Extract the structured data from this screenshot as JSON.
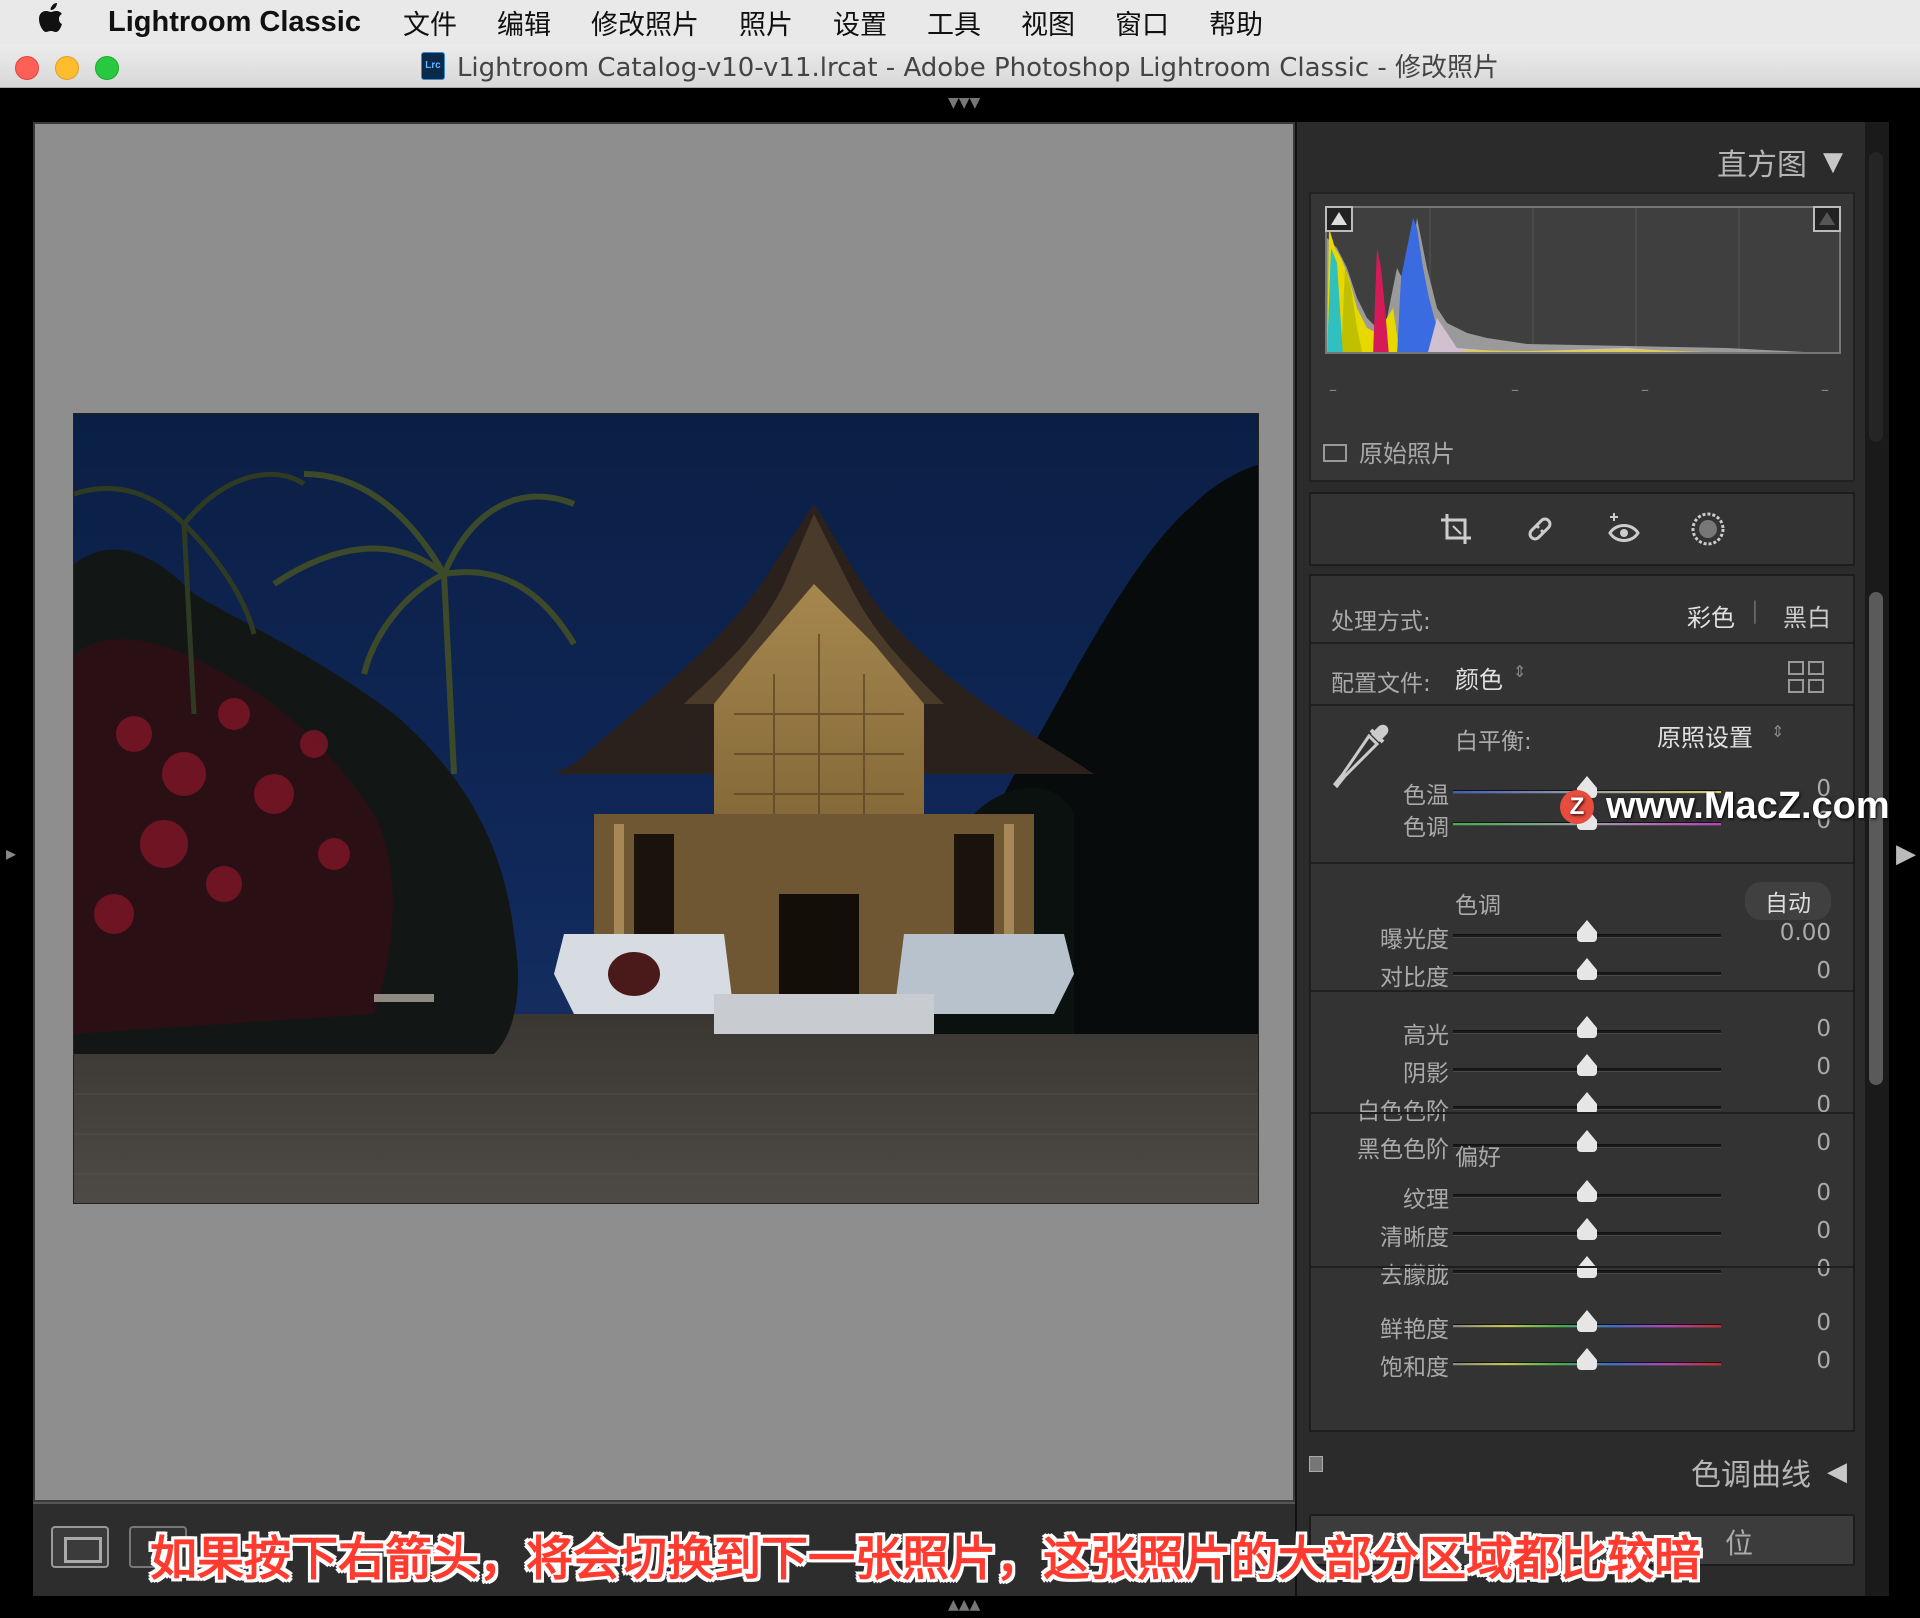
{
  "menubar": {
    "app_name": "Lightroom Classic",
    "items": [
      "文件",
      "编辑",
      "修改照片",
      "照片",
      "设置",
      "工具",
      "视图",
      "窗口",
      "帮助"
    ]
  },
  "window": {
    "title": "Lightroom Catalog-v10-v11.lrcat - Adobe Photoshop Lightroom Classic - 修改照片",
    "doc_icon_text": "Lrc"
  },
  "histogram": {
    "title": "直方图",
    "original_photo_label": "原始照片"
  },
  "basic": {
    "treatment_label": "处理方式:",
    "treatment_color": "彩色",
    "treatment_bw": "黑白",
    "profile_label": "配置文件:",
    "profile_value": "颜色",
    "wb_label": "白平衡:",
    "wb_value": "原照设置",
    "temp_label": "色温",
    "tint_label": "色调",
    "temp_value": "0",
    "tint_value": "0",
    "tone_header": "色调",
    "auto_label": "自动",
    "tone_sliders": [
      {
        "label": "曝光度",
        "value": "0.00"
      },
      {
        "label": "对比度",
        "value": "0"
      },
      {
        "label": "高光",
        "value": "0"
      },
      {
        "label": "阴影",
        "value": "0"
      },
      {
        "label": "白色色阶",
        "value": "0"
      },
      {
        "label": "黑色色阶",
        "value": "0"
      }
    ],
    "presence_header": "偏好",
    "presence_sliders": [
      {
        "label": "纹理",
        "value": "0"
      },
      {
        "label": "清晰度",
        "value": "0"
      },
      {
        "label": "去朦胧",
        "value": "0"
      },
      {
        "label": "鲜艳度",
        "value": "0"
      },
      {
        "label": "饱和度",
        "value": "0"
      }
    ]
  },
  "tone_curve": {
    "title": "色调曲线"
  },
  "bottom_button": {
    "label": "位"
  },
  "caption": "如果按下右箭头，将会切换到下一张照片，这张照片的大部分区域都比较暗",
  "watermark": "www.MacZ.com",
  "watermark_logo": "Z",
  "colors": {
    "panel_bg": "#333333",
    "caption_red": "#ff3b2f",
    "sky": "#0b1f45"
  }
}
